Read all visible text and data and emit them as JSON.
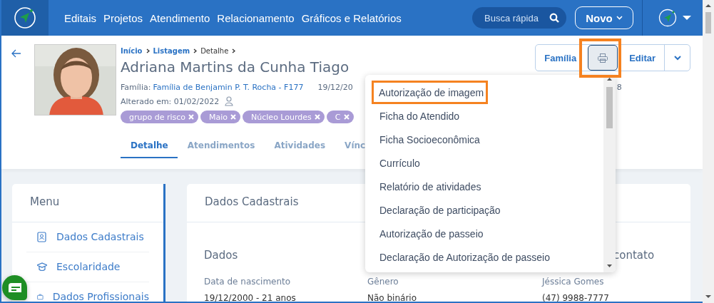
{
  "nav": {
    "items": [
      "Editais",
      "Projetos",
      "Atendimento",
      "Relacionamento",
      "Gráficos e Relatórios"
    ],
    "search_placeholder": "Busca rápida",
    "new_button": "Novo"
  },
  "breadcrumb": [
    "Início",
    "Listagem",
    "Detalhe"
  ],
  "person": {
    "name": "Adriana Martins da Cunha Tiago",
    "family_label": "Família:",
    "family_link": "Família de Benjamin P. T. Rocha - F177",
    "date_partial": "19/12/20",
    "meta_tail": "8",
    "changed": "Alterado em: 01/02/2022",
    "tags": [
      "grupo de risco",
      "Maio",
      "Núcleo Lourdes",
      "C"
    ]
  },
  "actions": {
    "family_button": "Família",
    "print_selected": true,
    "edit_button": "Editar"
  },
  "tabs": [
    {
      "label": "Detalhe",
      "selected": true
    },
    {
      "label": "Atendimentos",
      "selected": false
    },
    {
      "label": "Atividades",
      "selected": false
    },
    {
      "label": "Vínc",
      "selected": false
    }
  ],
  "print_menu": [
    {
      "label": "Autorização de imagem",
      "highlighted": true
    },
    {
      "label": "Ficha do Atendido",
      "highlighted": false
    },
    {
      "label": "Ficha Socioeconômica",
      "highlighted": false
    },
    {
      "label": "Currículo",
      "highlighted": false
    },
    {
      "label": "Relatório de atividades",
      "highlighted": false
    },
    {
      "label": "Declaração de participação",
      "highlighted": false
    },
    {
      "label": "Autorização de passeio",
      "highlighted": false
    },
    {
      "label": "Declaração de Autorização de passeio",
      "highlighted": false
    }
  ],
  "sidebar": {
    "title": "Menu",
    "items": [
      {
        "label": "Dados Cadastrais",
        "kind": "contact"
      },
      {
        "label": "Escolaridade",
        "kind": "graduation"
      },
      {
        "label": "Dados Profissionais",
        "kind": "briefcase"
      }
    ]
  },
  "main": {
    "title": "Dados Cadastrais",
    "headings": {
      "left": "Dados",
      "right": "contato"
    },
    "fields": [
      {
        "label": "Data de nascimento",
        "value": "19/12/2000 - 21 anos"
      },
      {
        "label": "Gênero",
        "value": "Não binário"
      },
      {
        "label": "Jéssica Gomes",
        "value": "(47) 9988-7777"
      }
    ]
  }
}
